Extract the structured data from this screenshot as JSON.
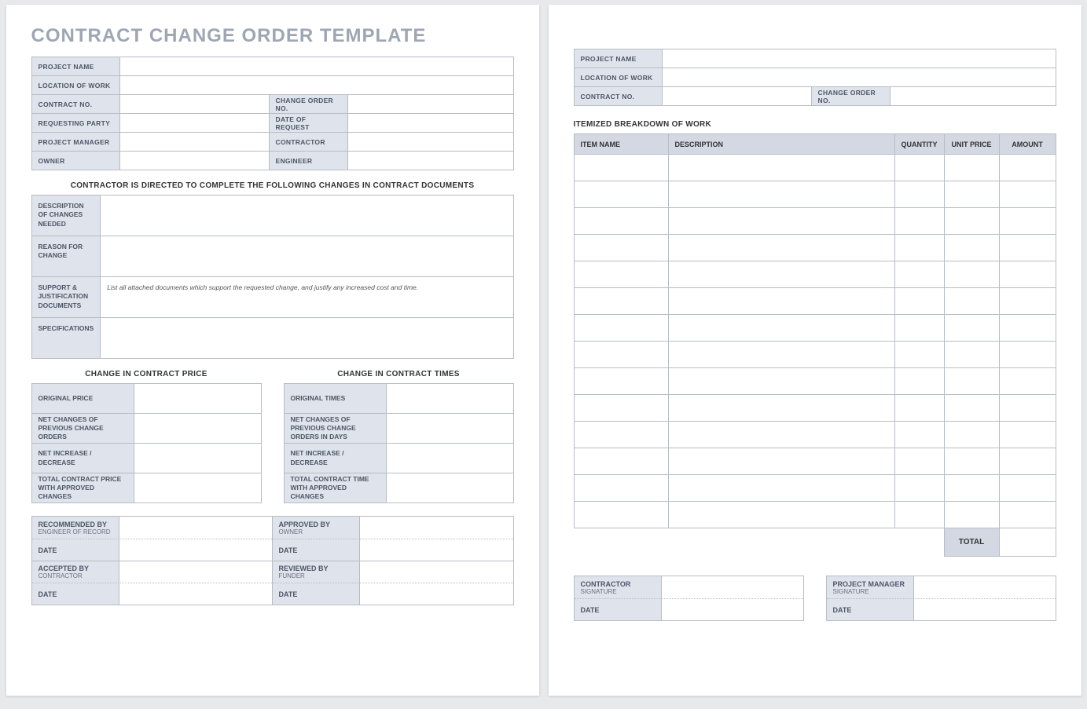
{
  "page1": {
    "title": "CONTRACT CHANGE ORDER TEMPLATE",
    "header": {
      "project_name": "PROJECT NAME",
      "location_of_work": "LOCATION OF WORK",
      "contract_no": "CONTRACT NO.",
      "change_order_no": "CHANGE ORDER NO.",
      "requesting_party": "REQUESTING PARTY",
      "date_of_request": "DATE OF REQUEST",
      "project_manager": "PROJECT MANAGER",
      "contractor": "CONTRACTOR",
      "owner": "OWNER",
      "engineer": "ENGINEER"
    },
    "banner": "CONTRACTOR IS DIRECTED TO COMPLETE THE FOLLOWING CHANGES IN CONTRACT DOCUMENTS",
    "desc": {
      "description_of_changes_needed": "DESCRIPTION OF CHANGES NEEDED",
      "reason_for_change": "REASON FOR CHANGE",
      "support_docs": "SUPPORT & JUSTIFICATION DOCUMENTS",
      "support_hint": "List all attached documents which support the requested change, and justify any increased cost and time.",
      "specifications": "SPECIFICATIONS"
    },
    "price": {
      "title": "CHANGE IN CONTRACT PRICE",
      "rows": [
        "ORIGINAL PRICE",
        "NET CHANGES OF PREVIOUS CHANGE ORDERS",
        "NET INCREASE / DECREASE",
        "TOTAL CONTRACT PRICE WITH APPROVED CHANGES"
      ]
    },
    "times": {
      "title": "CHANGE IN CONTRACT TIMES",
      "rows": [
        "ORIGINAL TIMES",
        "NET CHANGES OF PREVIOUS CHANGE ORDERS IN DAYS",
        "NET INCREASE / DECREASE",
        "TOTAL CONTRACT TIME WITH APPROVED CHANGES"
      ]
    },
    "sign": {
      "recommended_by": "RECOMMENDED BY",
      "engineer_of_record": "ENGINEER OF RECORD",
      "approved_by": "APPROVED BY",
      "owner": "OWNER",
      "accepted_by": "ACCEPTED BY",
      "contractor": "CONTRACTOR",
      "reviewed_by": "REVIEWED BY",
      "funder": "FUNDER",
      "date": "DATE"
    }
  },
  "page2": {
    "header": {
      "project_name": "PROJECT NAME",
      "location_of_work": "LOCATION OF WORK",
      "contract_no": "CONTRACT NO.",
      "change_order_no": "CHANGE ORDER NO."
    },
    "breakdown_title": "ITEMIZED BREAKDOWN OF WORK",
    "cols": [
      "ITEM NAME",
      "DESCRIPTION",
      "QUANTITY",
      "UNIT PRICE",
      "AMOUNT"
    ],
    "total": "TOTAL",
    "sign": {
      "contractor": "CONTRACTOR",
      "signature": "SIGNATURE",
      "project_manager": "PROJECT MANAGER",
      "date": "DATE"
    },
    "row_count": 14
  }
}
